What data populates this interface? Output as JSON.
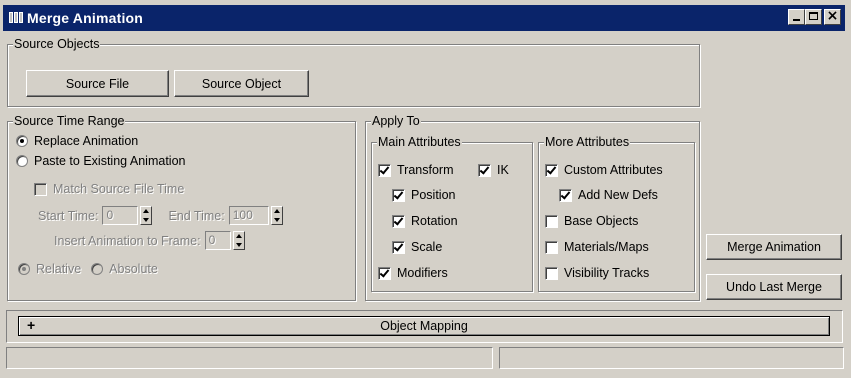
{
  "window": {
    "title": "Merge Animation",
    "title_bar_color": "#0a246a",
    "face_color": "#d4d0c8",
    "icons": [
      "app-icon",
      "minimize-icon",
      "maximize-icon",
      "close-icon"
    ]
  },
  "source_objects": {
    "legend": "Source Objects",
    "source_file_label": "Source File",
    "source_object_label": "Source Object"
  },
  "source_time_range": {
    "legend": "Source Time Range",
    "replace_label": "Replace Animation",
    "paste_label": "Paste to Existing Animation",
    "selected": "Replace Animation",
    "match_label": "Match Source File Time",
    "start_label": "Start Time:",
    "start_value": "0",
    "end_label": "End Time:",
    "end_value": "100",
    "insert_label": "Insert Animation to Frame:",
    "insert_value": "0",
    "relative_label": "Relative",
    "absolute_label": "Absolute"
  },
  "apply_to": {
    "legend": "Apply To",
    "main": {
      "legend": "Main Attributes",
      "transform": "Transform",
      "ik": "IK",
      "position": "Position",
      "rotation": "Rotation",
      "scale": "Scale",
      "modifiers": "Modifiers"
    },
    "more": {
      "legend": "More Attributes",
      "custom": "Custom Attributes",
      "add_new_defs": "Add New Defs",
      "base_objects": "Base Objects",
      "materials_maps": "Materials/Maps",
      "visibility_tracks": "Visibility Tracks"
    }
  },
  "actions": {
    "merge_label": "Merge Animation",
    "undo_label": "Undo Last Merge"
  },
  "rollout": {
    "expand_glyph": "+",
    "title": "Object Mapping"
  }
}
